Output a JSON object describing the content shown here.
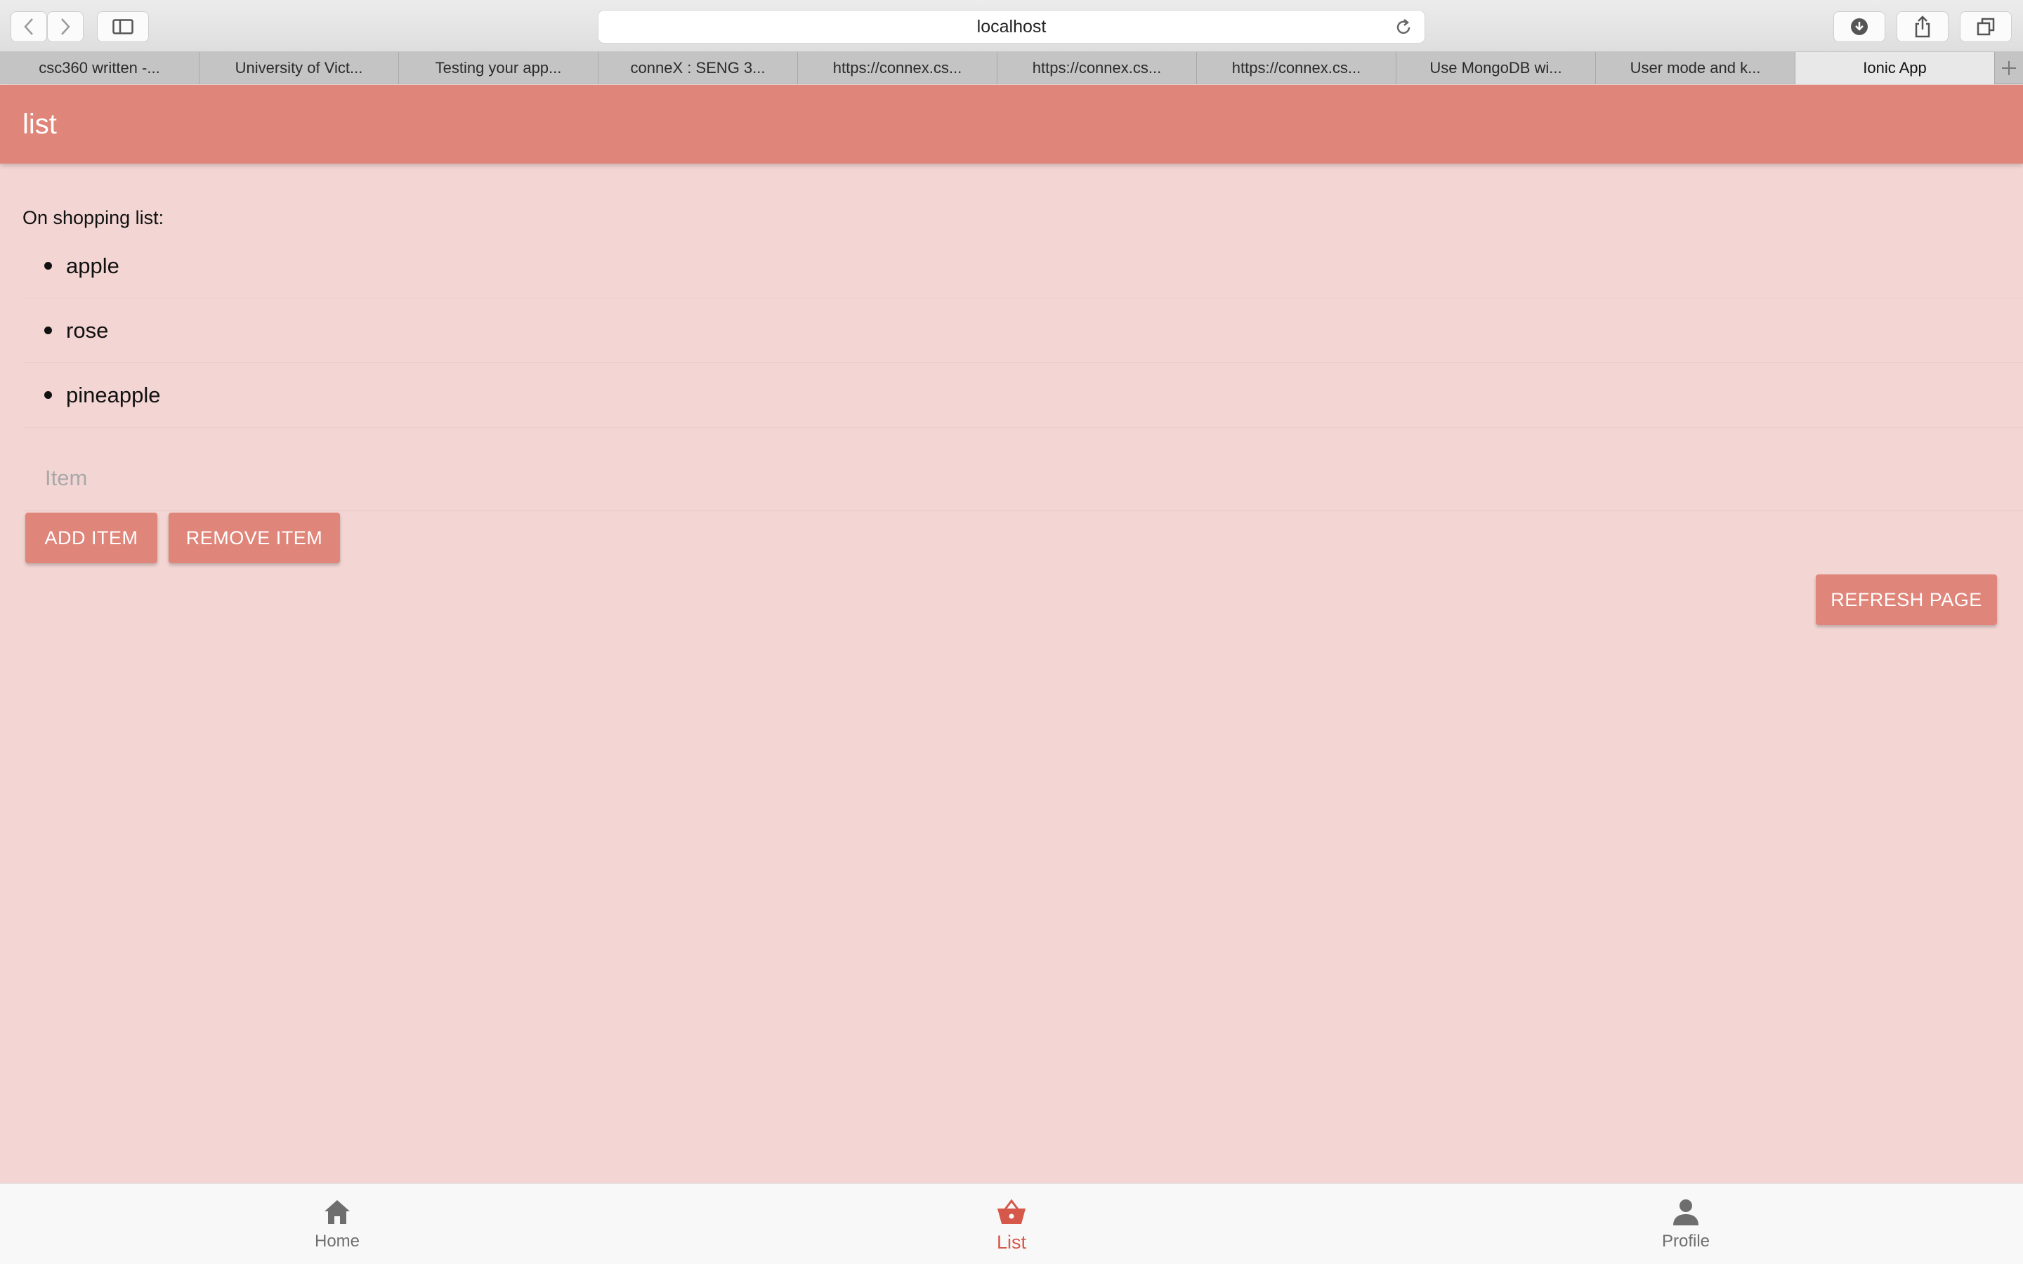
{
  "browser": {
    "url": "localhost",
    "tabs": [
      {
        "label": "csc360 written -..."
      },
      {
        "label": "University of Vict..."
      },
      {
        "label": "Testing your app..."
      },
      {
        "label": "conneX : SENG 3..."
      },
      {
        "label": "https://connex.cs..."
      },
      {
        "label": "https://connex.cs..."
      },
      {
        "label": "https://connex.cs..."
      },
      {
        "label": "Use MongoDB wi..."
      },
      {
        "label": "User mode and k..."
      },
      {
        "label": "Ionic App"
      }
    ],
    "active_tab_index": 9
  },
  "header": {
    "title": "list"
  },
  "main": {
    "list_heading": "On shopping list:",
    "items": [
      "apple",
      "rose",
      "pineapple"
    ],
    "item_input": {
      "value": "",
      "placeholder": "Item"
    },
    "add_button_label": "ADD ITEM",
    "remove_button_label": "REMOVE ITEM",
    "refresh_button_label": "REFRESH PAGE"
  },
  "tabbar": {
    "items": [
      {
        "label": "Home",
        "icon": "home-icon"
      },
      {
        "label": "List",
        "icon": "basket-icon"
      },
      {
        "label": "Profile",
        "icon": "person-icon"
      }
    ],
    "active": "List"
  },
  "colors": {
    "accent": "#e0857a",
    "background": "#f3d6d4",
    "active_tab": "#d6584b"
  }
}
